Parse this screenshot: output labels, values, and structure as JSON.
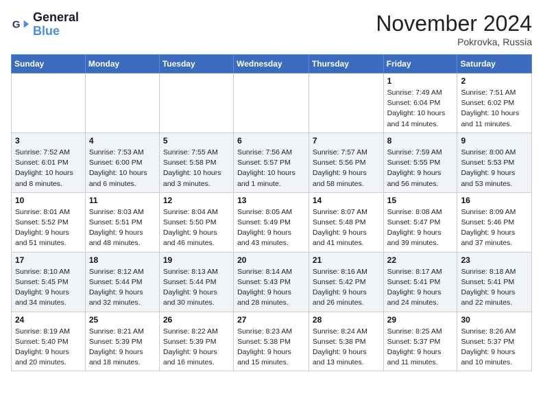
{
  "header": {
    "logo_line1": "General",
    "logo_line2": "Blue",
    "month_title": "November 2024",
    "location": "Pokrovka, Russia"
  },
  "days_of_week": [
    "Sunday",
    "Monday",
    "Tuesday",
    "Wednesday",
    "Thursday",
    "Friday",
    "Saturday"
  ],
  "weeks": [
    [
      {
        "day": "",
        "info": ""
      },
      {
        "day": "",
        "info": ""
      },
      {
        "day": "",
        "info": ""
      },
      {
        "day": "",
        "info": ""
      },
      {
        "day": "",
        "info": ""
      },
      {
        "day": "1",
        "info": "Sunrise: 7:49 AM\nSunset: 6:04 PM\nDaylight: 10 hours and 14 minutes."
      },
      {
        "day": "2",
        "info": "Sunrise: 7:51 AM\nSunset: 6:02 PM\nDaylight: 10 hours and 11 minutes."
      }
    ],
    [
      {
        "day": "3",
        "info": "Sunrise: 7:52 AM\nSunset: 6:01 PM\nDaylight: 10 hours and 8 minutes."
      },
      {
        "day": "4",
        "info": "Sunrise: 7:53 AM\nSunset: 6:00 PM\nDaylight: 10 hours and 6 minutes."
      },
      {
        "day": "5",
        "info": "Sunrise: 7:55 AM\nSunset: 5:58 PM\nDaylight: 10 hours and 3 minutes."
      },
      {
        "day": "6",
        "info": "Sunrise: 7:56 AM\nSunset: 5:57 PM\nDaylight: 10 hours and 1 minute."
      },
      {
        "day": "7",
        "info": "Sunrise: 7:57 AM\nSunset: 5:56 PM\nDaylight: 9 hours and 58 minutes."
      },
      {
        "day": "8",
        "info": "Sunrise: 7:59 AM\nSunset: 5:55 PM\nDaylight: 9 hours and 56 minutes."
      },
      {
        "day": "9",
        "info": "Sunrise: 8:00 AM\nSunset: 5:53 PM\nDaylight: 9 hours and 53 minutes."
      }
    ],
    [
      {
        "day": "10",
        "info": "Sunrise: 8:01 AM\nSunset: 5:52 PM\nDaylight: 9 hours and 51 minutes."
      },
      {
        "day": "11",
        "info": "Sunrise: 8:03 AM\nSunset: 5:51 PM\nDaylight: 9 hours and 48 minutes."
      },
      {
        "day": "12",
        "info": "Sunrise: 8:04 AM\nSunset: 5:50 PM\nDaylight: 9 hours and 46 minutes."
      },
      {
        "day": "13",
        "info": "Sunrise: 8:05 AM\nSunset: 5:49 PM\nDaylight: 9 hours and 43 minutes."
      },
      {
        "day": "14",
        "info": "Sunrise: 8:07 AM\nSunset: 5:48 PM\nDaylight: 9 hours and 41 minutes."
      },
      {
        "day": "15",
        "info": "Sunrise: 8:08 AM\nSunset: 5:47 PM\nDaylight: 9 hours and 39 minutes."
      },
      {
        "day": "16",
        "info": "Sunrise: 8:09 AM\nSunset: 5:46 PM\nDaylight: 9 hours and 37 minutes."
      }
    ],
    [
      {
        "day": "17",
        "info": "Sunrise: 8:10 AM\nSunset: 5:45 PM\nDaylight: 9 hours and 34 minutes."
      },
      {
        "day": "18",
        "info": "Sunrise: 8:12 AM\nSunset: 5:44 PM\nDaylight: 9 hours and 32 minutes."
      },
      {
        "day": "19",
        "info": "Sunrise: 8:13 AM\nSunset: 5:44 PM\nDaylight: 9 hours and 30 minutes."
      },
      {
        "day": "20",
        "info": "Sunrise: 8:14 AM\nSunset: 5:43 PM\nDaylight: 9 hours and 28 minutes."
      },
      {
        "day": "21",
        "info": "Sunrise: 8:16 AM\nSunset: 5:42 PM\nDaylight: 9 hours and 26 minutes."
      },
      {
        "day": "22",
        "info": "Sunrise: 8:17 AM\nSunset: 5:41 PM\nDaylight: 9 hours and 24 minutes."
      },
      {
        "day": "23",
        "info": "Sunrise: 8:18 AM\nSunset: 5:41 PM\nDaylight: 9 hours and 22 minutes."
      }
    ],
    [
      {
        "day": "24",
        "info": "Sunrise: 8:19 AM\nSunset: 5:40 PM\nDaylight: 9 hours and 20 minutes."
      },
      {
        "day": "25",
        "info": "Sunrise: 8:21 AM\nSunset: 5:39 PM\nDaylight: 9 hours and 18 minutes."
      },
      {
        "day": "26",
        "info": "Sunrise: 8:22 AM\nSunset: 5:39 PM\nDaylight: 9 hours and 16 minutes."
      },
      {
        "day": "27",
        "info": "Sunrise: 8:23 AM\nSunset: 5:38 PM\nDaylight: 9 hours and 15 minutes."
      },
      {
        "day": "28",
        "info": "Sunrise: 8:24 AM\nSunset: 5:38 PM\nDaylight: 9 hours and 13 minutes."
      },
      {
        "day": "29",
        "info": "Sunrise: 8:25 AM\nSunset: 5:37 PM\nDaylight: 9 hours and 11 minutes."
      },
      {
        "day": "30",
        "info": "Sunrise: 8:26 AM\nSunset: 5:37 PM\nDaylight: 9 hours and 10 minutes."
      }
    ]
  ]
}
